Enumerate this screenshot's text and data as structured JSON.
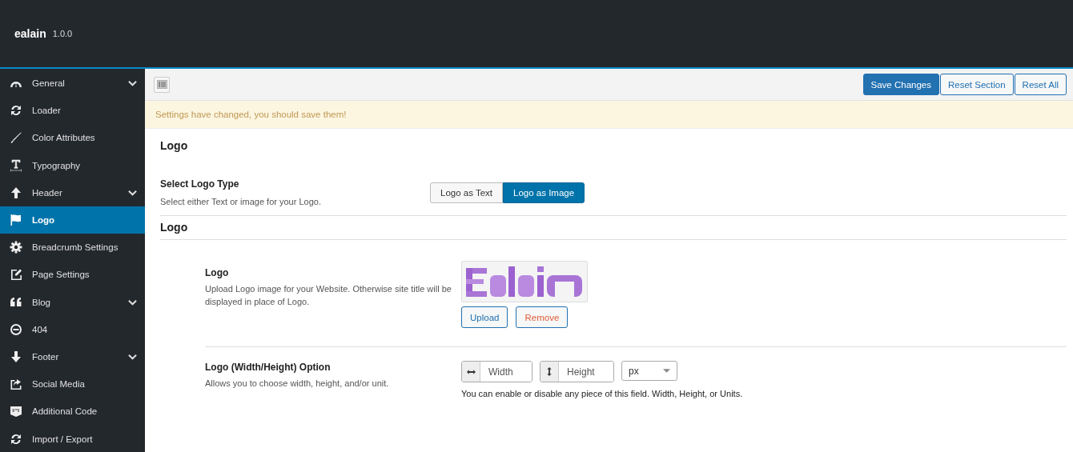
{
  "header": {
    "title": "ealain",
    "version": "1.0.0"
  },
  "sidebar": {
    "items": [
      {
        "label": "General",
        "selected": false,
        "expandable": true
      },
      {
        "label": "Loader",
        "selected": false,
        "expandable": false
      },
      {
        "label": "Color Attributes",
        "selected": false,
        "expandable": false
      },
      {
        "label": "Typography",
        "selected": false,
        "expandable": false
      },
      {
        "label": "Header",
        "selected": false,
        "expandable": true
      },
      {
        "label": "Logo",
        "selected": true,
        "expandable": false
      },
      {
        "label": "Breadcrumb Settings",
        "selected": false,
        "expandable": false
      },
      {
        "label": "Page Settings",
        "selected": false,
        "expandable": false
      },
      {
        "label": "Blog",
        "selected": false,
        "expandable": true
      },
      {
        "label": "404",
        "selected": false,
        "expandable": false
      },
      {
        "label": "Footer",
        "selected": false,
        "expandable": true
      },
      {
        "label": "Social Media",
        "selected": false,
        "expandable": false
      },
      {
        "label": "Additional Code",
        "selected": false,
        "expandable": false
      },
      {
        "label": "Import / Export",
        "selected": false,
        "expandable": false
      }
    ]
  },
  "toolbar": {
    "buttons": [
      {
        "label": "Save Changes",
        "kind": "primary"
      },
      {
        "label": "Reset Section",
        "kind": "secondary"
      },
      {
        "label": "Reset All",
        "kind": "secondary"
      }
    ]
  },
  "notice": "Settings have changed, you should save them!",
  "section_title": "Logo",
  "logo_type": {
    "label": "Select Logo Type",
    "description": "Select either Text or image for your Logo.",
    "options": [
      {
        "label": "Logo as Text",
        "selected": false
      },
      {
        "label": "Logo as Image",
        "selected": true
      }
    ]
  },
  "subsection_title": "Logo",
  "logo_field": {
    "label": "Logo",
    "description": "Upload Logo image for your Website. Otherwise site title will be displayed in place of Logo.",
    "buttons": [
      {
        "label": "Upload",
        "kind": "upload"
      },
      {
        "label": "Remove",
        "kind": "remove"
      }
    ]
  },
  "dimensions": {
    "label": "Logo (Width/Height) Option",
    "description": "Allows you to choose width, height, and/or unit.",
    "width_placeholder": "Width",
    "height_placeholder": "Height",
    "unit": "px",
    "help": "You can enable or disable any piece of this field. Width, Height, or Units."
  }
}
